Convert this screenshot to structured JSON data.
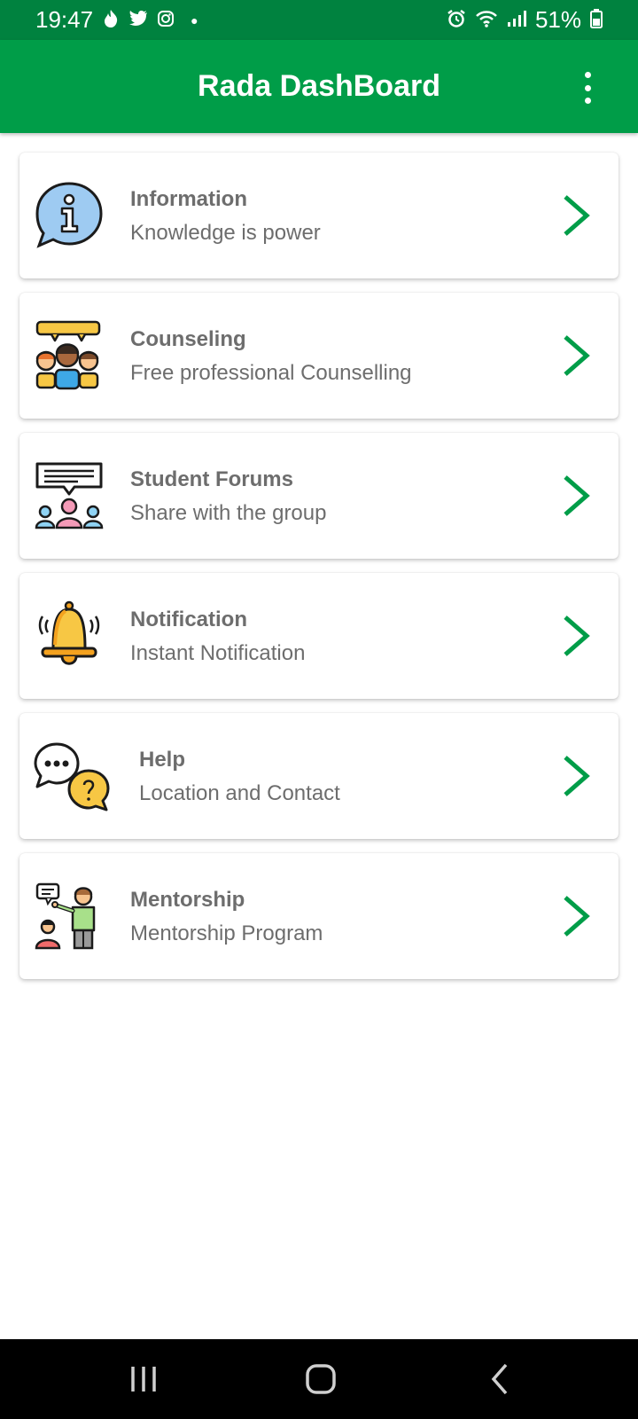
{
  "status_bar": {
    "time": "19:47",
    "notification_icons": [
      "flame-icon",
      "twitter-icon",
      "instagram-icon",
      "dot"
    ],
    "system_icons": [
      "alarm-icon",
      "wifi-icon",
      "signal-icon"
    ],
    "battery": "51%"
  },
  "app_bar": {
    "title": "Rada DashBoard",
    "menu_icon": "overflow-menu-icon"
  },
  "colors": {
    "status_bar": "#00823f",
    "app_bar": "#009d48",
    "accent": "#009d48",
    "text": "#6d6d6d"
  },
  "menu": [
    {
      "title": "Information",
      "subtitle": "Knowledge is power",
      "icon": "info-bubble-icon"
    },
    {
      "title": "Counseling",
      "subtitle": "Free professional Counselling",
      "icon": "counseling-group-icon"
    },
    {
      "title": "Student Forums",
      "subtitle": "Share with the group",
      "icon": "forum-group-icon"
    },
    {
      "title": "Notification",
      "subtitle": "Instant Notification",
      "icon": "bell-icon"
    },
    {
      "title": "Help",
      "subtitle": "Location and Contact",
      "icon": "help-chat-icon"
    },
    {
      "title": "Mentorship",
      "subtitle": "Mentorship Program",
      "icon": "mentor-icon"
    }
  ],
  "nav_bar": {
    "buttons": [
      "recent-apps-icon",
      "home-icon",
      "back-icon"
    ]
  }
}
